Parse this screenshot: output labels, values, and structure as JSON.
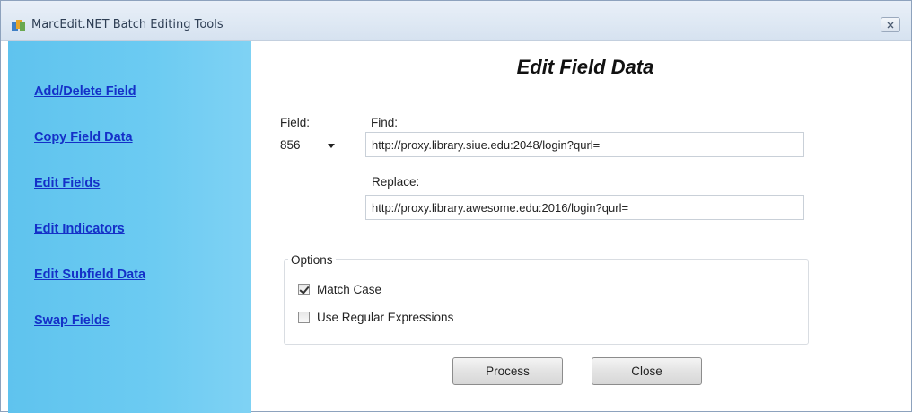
{
  "window": {
    "title": "MarcEdit.NET Batch Editing Tools",
    "icon": "app-icon",
    "close_icon": "close-icon"
  },
  "sidebar": {
    "items": [
      {
        "label": "Add/Delete Field"
      },
      {
        "label": "Copy Field Data"
      },
      {
        "label": "Edit Fields"
      },
      {
        "label": "Edit Indicators"
      },
      {
        "label": "Edit Subfield Data"
      },
      {
        "label": "Swap Fields"
      }
    ],
    "link_color": "#1430c8",
    "background_color": "#6ccbf2"
  },
  "main": {
    "heading": "Edit Field Data",
    "field_label": "Field:",
    "field_value": "856",
    "find_label": "Find:",
    "find_value": "http://proxy.library.siue.edu:2048/login?qurl=",
    "replace_label": "Replace:",
    "replace_value": "http://proxy.library.awesome.edu:2016/login?qurl=",
    "options": {
      "title": "Options",
      "match_case_label": "Match Case",
      "match_case_checked": true,
      "regex_label": "Use Regular Expressions",
      "regex_checked": false
    },
    "process_label": "Process",
    "close_label": "Close"
  }
}
